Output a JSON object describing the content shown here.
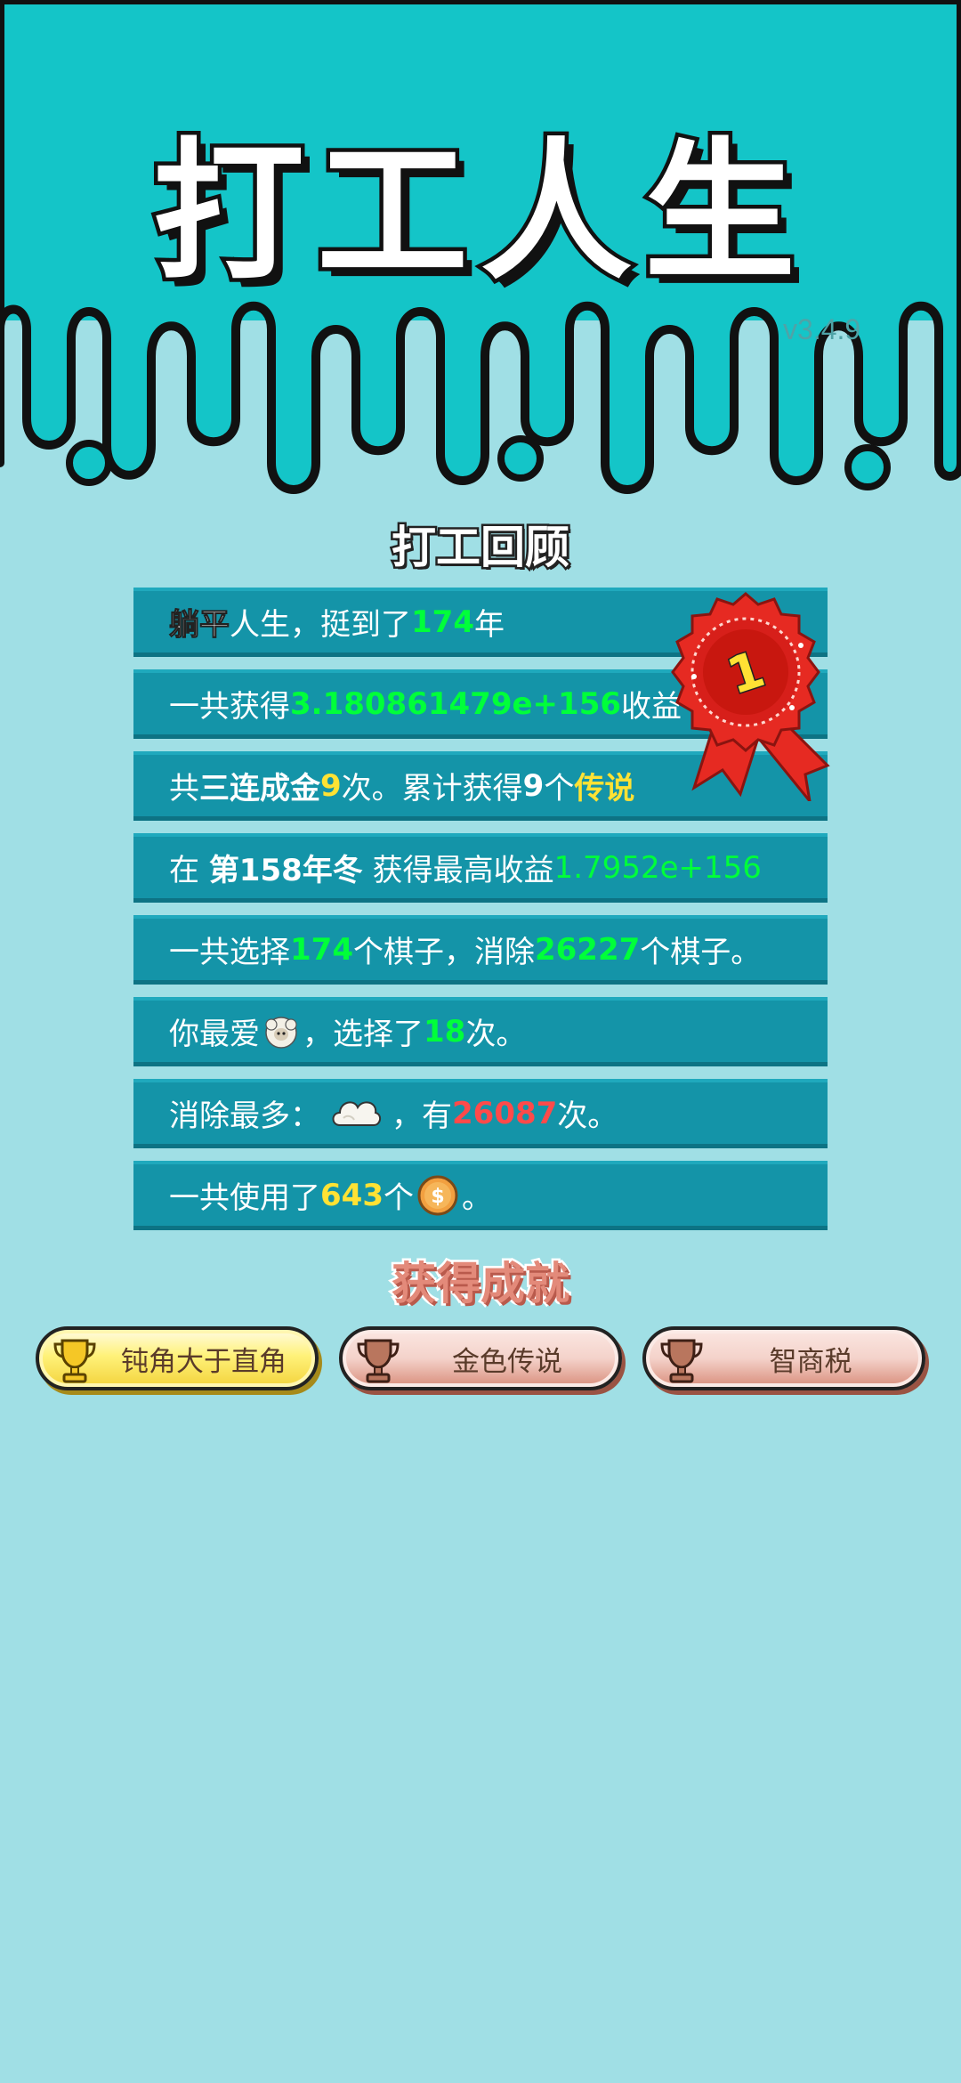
{
  "app": {
    "title": "打工人生",
    "version": "v3.4.9"
  },
  "review": {
    "heading": "打工回顾",
    "rows": [
      {
        "parts": [
          "躺平",
          "人生，挺到了",
          "174",
          "年"
        ]
      },
      {
        "parts": [
          "一共获得",
          "3.180861479e+156",
          "收益"
        ]
      },
      {
        "parts": [
          "共",
          "三连成金",
          "9",
          "次。累计获得",
          "9",
          "个",
          "传说"
        ]
      },
      {
        "parts": [
          "在 ",
          "第158年冬",
          " 获得最高收益",
          "1.7952e+156"
        ]
      },
      {
        "parts": [
          "一共选择",
          "174",
          "个棋子，消除",
          "26227",
          "个棋子。"
        ]
      },
      {
        "parts": [
          "你最爱",
          "，选择了",
          "18",
          "次。"
        ],
        "icon": "sheep-icon"
      },
      {
        "parts": [
          "消除最多：",
          "，有",
          "26087",
          "次。"
        ],
        "icon": "cloud-icon"
      },
      {
        "parts": [
          "一共使用了",
          "643",
          "个",
          "。"
        ],
        "icon": "coin-icon"
      }
    ],
    "medal": {
      "number": "1",
      "icon": "rank-medal-icon"
    }
  },
  "achievements": {
    "heading": "获得成就",
    "items": [
      {
        "label": "钝角大于直角",
        "tier": "gold",
        "icon": "trophy-icon"
      },
      {
        "label": "金色传说",
        "tier": "bronze",
        "icon": "trophy-icon"
      },
      {
        "label": "智商税",
        "tier": "bronze",
        "icon": "trophy-icon"
      }
    ]
  },
  "colors": {
    "header_bg": "#14c5c8",
    "page_bg": "#a0dfe5",
    "row_bg": "#1494a8",
    "highlight_green": "#00ff3a",
    "highlight_yellow": "#ffe234",
    "highlight_red": "#ff4a4a"
  }
}
